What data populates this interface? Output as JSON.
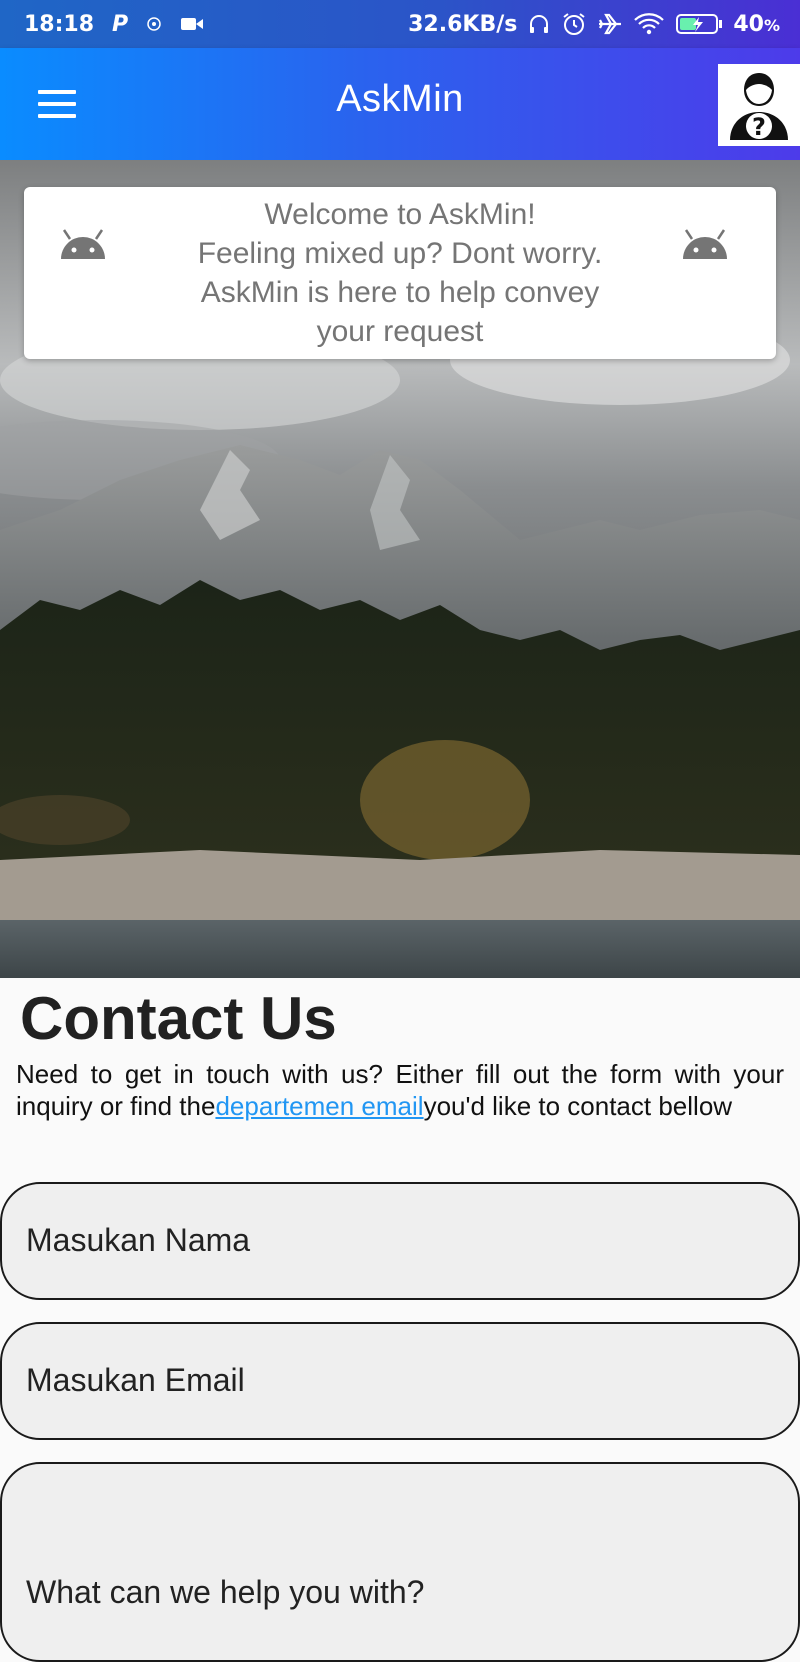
{
  "status_bar": {
    "time": "18:18",
    "p_badge": "P",
    "speed": "32.6KB/s",
    "battery": "40",
    "battery_unit": "%"
  },
  "app_bar": {
    "title": "AskMin"
  },
  "welcome": {
    "line1": "Welcome to AskMin!",
    "line2": "Feeling mixed up? Dont worry.",
    "line3": "AskMin is here to help convey",
    "line4": "your request"
  },
  "contact": {
    "title": "Contact Us",
    "desc_before": "Need to get in touch with us? Either fill out the form with your inquiry or find the",
    "desc_link": "departemen email",
    "desc_after": "you'd like to contact bellow"
  },
  "form": {
    "name_placeholder": "Masukan Nama",
    "email_placeholder": "Masukan Email",
    "message_placeholder": "What can we help you with?"
  },
  "colors": {
    "accent": "#2196f3",
    "app_bar_start": "#0a8cff",
    "app_bar_end": "#4d3bea"
  },
  "icons": [
    "menu-icon",
    "support-avatar-icon",
    "android-icon",
    "headphones-icon",
    "alarm-icon",
    "airplane-icon",
    "wifi-icon",
    "battery-icon",
    "video-icon"
  ]
}
